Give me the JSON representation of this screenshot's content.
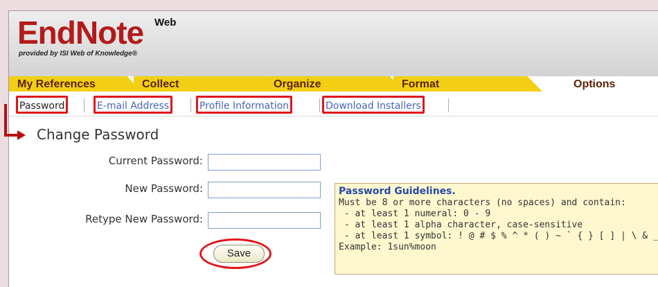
{
  "logo": {
    "title": "EndNote",
    "superscript": "Web",
    "subtitle": "provided by ISI Web of Knowledge®"
  },
  "tabs": [
    {
      "label": "My References"
    },
    {
      "label": "Collect"
    },
    {
      "label": "Organize"
    },
    {
      "label": "Format"
    },
    {
      "label": "Options"
    }
  ],
  "subnav": [
    {
      "label": "Password"
    },
    {
      "label": "E-mail Address"
    },
    {
      "label": "Profile Information"
    },
    {
      "label": "Download Installers"
    }
  ],
  "page_title": "Change Password",
  "form": {
    "current_label": "Current Password:",
    "new_label": "New Password:",
    "retype_label": "Retype New Password:",
    "current_value": "",
    "new_value": "",
    "retype_value": "",
    "save_label": "Save"
  },
  "guidelines": {
    "title": "Password Guidelines.",
    "lines": [
      "Must be 8 or more characters (no spaces) and contain:",
      " - at least 1 numeral: 0 - 9",
      " - at least 1 alpha character, case-sensitive",
      " - at least 1 symbol: ! @ # $ % ^ * ( ) ~ ` { } [ ] | \\ & _",
      "Example: 1sun%moon"
    ]
  },
  "colors": {
    "accent_red": "#e0151b",
    "tab_yellow": "#f2cf13",
    "link_blue": "#4b62b8",
    "guide_bg": "#fff8cf"
  }
}
